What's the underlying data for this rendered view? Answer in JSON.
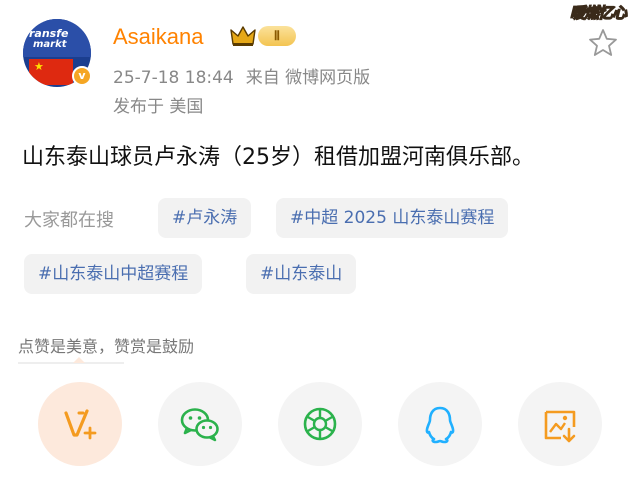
{
  "post": {
    "author": {
      "name": "Asaikana",
      "rank_label": "Ⅱ",
      "avatar_text_line1": "ransfe",
      "avatar_text_line2": "markt",
      "verified_badge": "v"
    },
    "meta": {
      "datetime": "25-7-18 18:44",
      "source": "来自 微博网页版",
      "location": "发布于 美国"
    },
    "text": "山东泰山球员卢永涛（25岁）租借加盟河南俱乐部。",
    "corner_badge": "暖燃忆心"
  },
  "search": {
    "label": "大家都在搜",
    "tags": [
      "#卢永涛",
      "#中超 2025 山东泰山赛程",
      "#山东泰山中超赛程",
      "#山东泰山"
    ]
  },
  "reward": {
    "caption": "点赞是美意，赞赏是鼓励"
  },
  "share": {
    "buttons": [
      {
        "icon": "reward-icon"
      },
      {
        "icon": "wechat-icon"
      },
      {
        "icon": "moments-icon"
      },
      {
        "icon": "qq-icon"
      },
      {
        "icon": "save-image-icon"
      }
    ]
  },
  "colors": {
    "username": "#ff8200",
    "tag_text": "#4a6eb0",
    "tag_bg": "#f2f2f2",
    "wechat": "#2bb24c",
    "qq": "#20b0ff",
    "save": "#f49b20",
    "reward": "#f49b20"
  }
}
